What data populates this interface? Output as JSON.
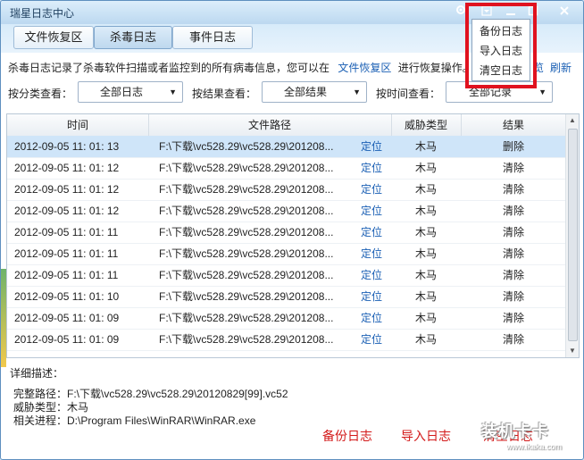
{
  "window": {
    "title": "瑞星日志中心"
  },
  "tabs": [
    {
      "label": "文件恢复区",
      "active": false
    },
    {
      "label": "杀毒日志",
      "active": true
    },
    {
      "label": "事件日志",
      "active": false
    }
  ],
  "info": {
    "text_before": "杀毒日志记录了杀毒软件扫描或者监控到的所有病毒信息，您可以在",
    "link": "文件恢复区",
    "text_after": "进行恢复操作。",
    "stray": "览",
    "refresh": "刷新"
  },
  "filters": {
    "category": {
      "label": "按分类查看：",
      "value": "全部日志"
    },
    "result": {
      "label": "按结果查看：",
      "value": "全部结果"
    },
    "time": {
      "label": "按时间查看：",
      "value": "全部记录"
    }
  },
  "table": {
    "columns": [
      "时间",
      "文件路径",
      "威胁类型",
      "结果"
    ],
    "locate_label": "定位",
    "rows": [
      {
        "time": "2012-09-05 11: 01: 13",
        "path": "F:\\下载\\vc528.29\\vc528.29\\201208...",
        "threat": "木马",
        "result": "删除",
        "selected": true
      },
      {
        "time": "2012-09-05 11: 01: 12",
        "path": "F:\\下载\\vc528.29\\vc528.29\\201208...",
        "threat": "木马",
        "result": "清除"
      },
      {
        "time": "2012-09-05 11: 01: 12",
        "path": "F:\\下载\\vc528.29\\vc528.29\\201208...",
        "threat": "木马",
        "result": "清除"
      },
      {
        "time": "2012-09-05 11: 01: 12",
        "path": "F:\\下载\\vc528.29\\vc528.29\\201208...",
        "threat": "木马",
        "result": "清除"
      },
      {
        "time": "2012-09-05 11: 01: 11",
        "path": "F:\\下载\\vc528.29\\vc528.29\\201208...",
        "threat": "木马",
        "result": "清除"
      },
      {
        "time": "2012-09-05 11: 01: 11",
        "path": "F:\\下载\\vc528.29\\vc528.29\\201208...",
        "threat": "木马",
        "result": "清除"
      },
      {
        "time": "2012-09-05 11: 01: 11",
        "path": "F:\\下载\\vc528.29\\vc528.29\\201208...",
        "threat": "木马",
        "result": "清除"
      },
      {
        "time": "2012-09-05 11: 01: 10",
        "path": "F:\\下载\\vc528.29\\vc528.29\\201208...",
        "threat": "木马",
        "result": "清除"
      },
      {
        "time": "2012-09-05 11: 01: 09",
        "path": "F:\\下载\\vc528.29\\vc528.29\\201208...",
        "threat": "木马",
        "result": "清除"
      },
      {
        "time": "2012-09-05 11: 01: 09",
        "path": "F:\\下载\\vc528.29\\vc528.29\\201208...",
        "threat": "木马",
        "result": "清除"
      }
    ]
  },
  "detail": {
    "title": "详细描述：",
    "path_line": "完整路径：F:\\下载\\vc528.29\\vc528.29\\20120829[99].vc52",
    "threat_line": "威胁类型：木马",
    "process_line": "相关进程：D:\\Program Files\\WinRAR\\WinRAR.exe"
  },
  "actions": {
    "backup": "备份日志",
    "import": "导入日志",
    "clear": "清空日志"
  },
  "dropdown_menu": [
    "备份日志",
    "导入日志",
    "清空日志"
  ],
  "watermark": {
    "line1": "装机卡卡",
    "line2": "www.ikaka.com"
  },
  "colors": {
    "accent_link": "#1a5fb4",
    "action_red": "#d31a1a",
    "highlight_box": "#e0121f",
    "selected_row": "#cfe5f9"
  }
}
